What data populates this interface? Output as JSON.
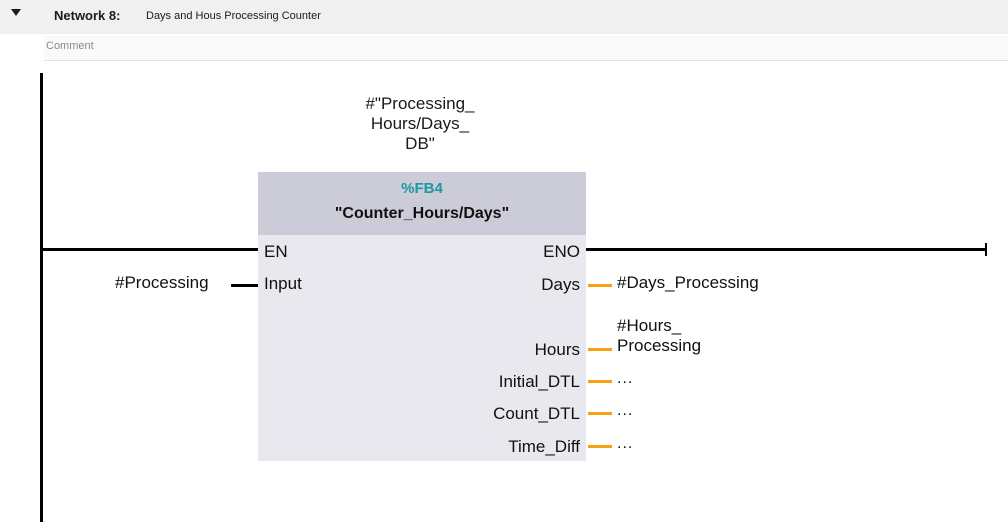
{
  "network": {
    "title": "Network 8:",
    "description": "Days and Hous Processing Counter",
    "comment_placeholder": "Comment"
  },
  "block": {
    "instance_line1": "#\"Processing_",
    "instance_line2": "Hours/Days_",
    "instance_line3": "DB\"",
    "fb_number": "%FB4",
    "fb_name": "\"Counter_Hours/Days\""
  },
  "inputs": {
    "en": "EN",
    "input": "Input"
  },
  "outputs": {
    "eno": "ENO",
    "days": "Days",
    "hours": "Hours",
    "initial_dtl": "Initial_DTL",
    "count_dtl": "Count_DTL",
    "time_diff": "Time_Diff"
  },
  "operands": {
    "input": "#Processing",
    "days": "#Days_Processing",
    "hours_line1": "#Hours_",
    "hours_line2": "Processing",
    "initial_dtl": "...",
    "count_dtl": "...",
    "time_diff": "..."
  },
  "colors": {
    "header_bg": "#f0f0f0",
    "fb_header": "#ccccd8",
    "fb_body": "#e8e8ee",
    "fb_number": "#1a9aa2",
    "output_wire": "#f7a117"
  }
}
